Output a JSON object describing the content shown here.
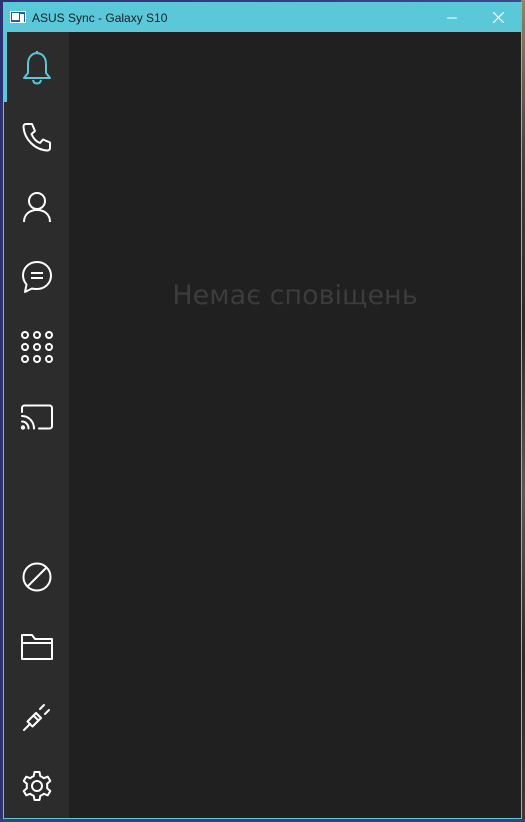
{
  "window": {
    "title": "ASUS Sync - Galaxy S10",
    "accent_color": "#5ac8d8",
    "controls": [
      "minimize-icon",
      "close-icon"
    ]
  },
  "sidebar": {
    "items": [
      {
        "id": "notifications",
        "icon": "bell-icon",
        "active": true
      },
      {
        "id": "calls",
        "icon": "phone-icon",
        "active": false
      },
      {
        "id": "contacts",
        "icon": "person-icon",
        "active": false
      },
      {
        "id": "messages",
        "icon": "chat-bubble-icon",
        "active": false
      },
      {
        "id": "dialpad",
        "icon": "dialpad-icon",
        "active": false
      },
      {
        "id": "screen-cast",
        "icon": "cast-icon",
        "active": false
      }
    ],
    "bottom_items": [
      {
        "id": "block",
        "icon": "block-icon"
      },
      {
        "id": "files",
        "icon": "folder-icon"
      },
      {
        "id": "connection",
        "icon": "plug-icon"
      },
      {
        "id": "settings",
        "icon": "gear-icon"
      }
    ]
  },
  "main": {
    "empty_message": "Немає сповіщень"
  }
}
